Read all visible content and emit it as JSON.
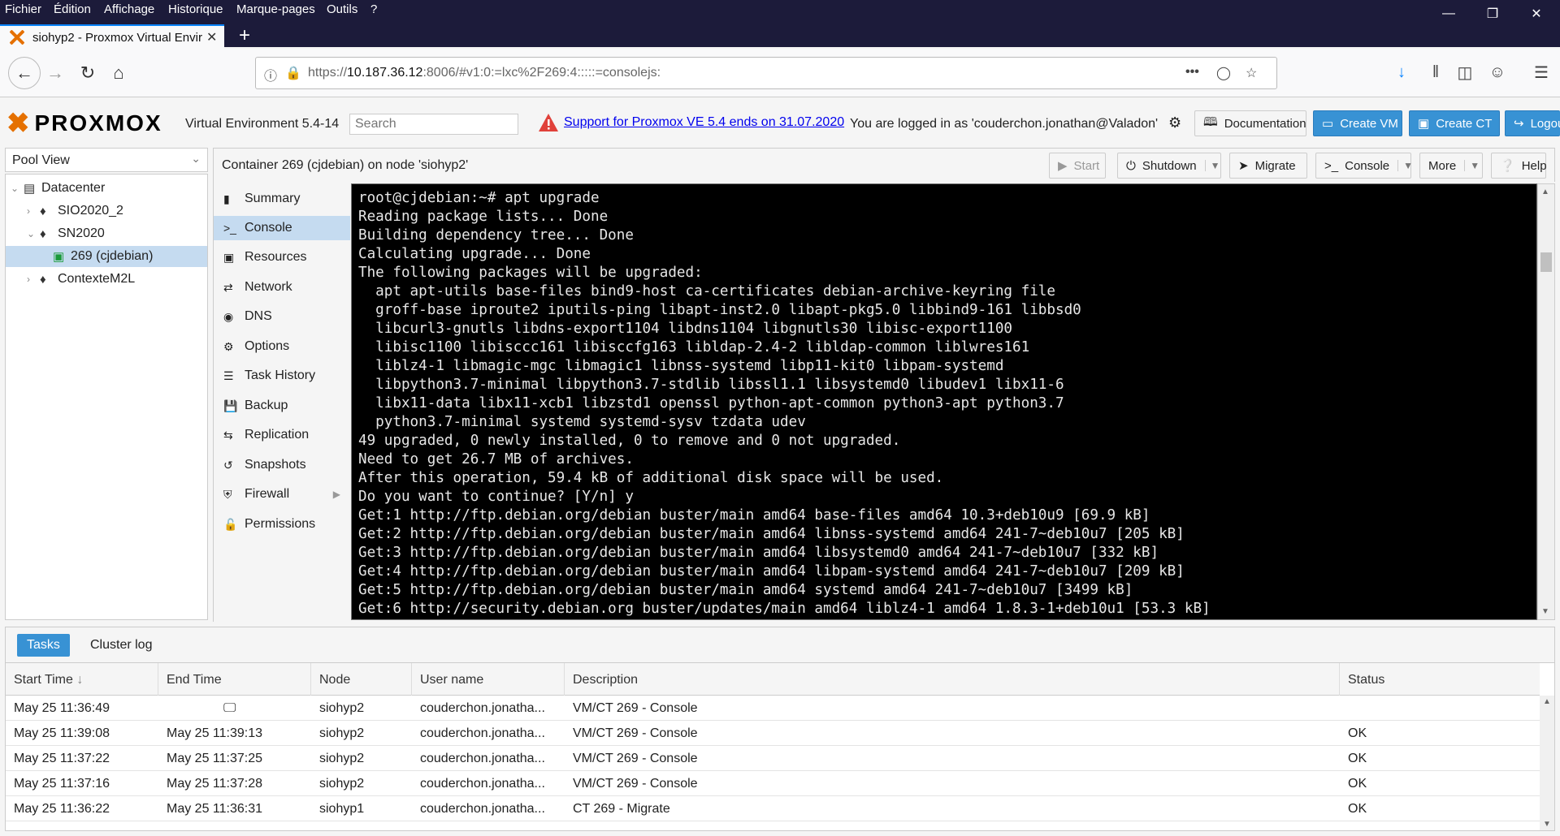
{
  "browser": {
    "menu": [
      "Fichier",
      "Édition",
      "Affichage",
      "Historique",
      "Marque-pages",
      "Outils",
      "?"
    ],
    "tab_title": "siohyp2 - Proxmox Virtual Envir",
    "url_prefix": "https://",
    "url_host": "10.187.36.12",
    "url_rest": ":8006/#v1:0:=lxc%2F269:4:::::=consolejs:"
  },
  "header": {
    "logo": "PROXMOX",
    "version": "Virtual Environment 5.4-14",
    "search_placeholder": "Search",
    "support_link": "Support for Proxmox VE 5.4 ends on 31.07.2020",
    "logged_in": "You are logged in as 'couderchon.jonathan@Valadon'",
    "documentation": "Documentation",
    "create_vm": "Create VM",
    "create_ct": "Create CT",
    "logout": "Logou"
  },
  "tree": {
    "view": "Pool View",
    "nodes": [
      "Datacenter",
      "SIO2020_2",
      "SN2020",
      "269 (cjdebian)",
      "ContexteM2L"
    ]
  },
  "content": {
    "title": "Container 269 (cjdebian) on node 'siohyp2'",
    "buttons": {
      "start": "Start",
      "shutdown": "Shutdown",
      "migrate": "Migrate",
      "console": "Console",
      "more": "More",
      "help": "Help"
    },
    "nav": [
      "Summary",
      "Console",
      "Resources",
      "Network",
      "DNS",
      "Options",
      "Task History",
      "Backup",
      "Replication",
      "Snapshots",
      "Firewall",
      "Permissions"
    ]
  },
  "terminal": {
    "lines": [
      "root@cjdebian:~# apt upgrade",
      "Reading package lists... Done",
      "Building dependency tree... Done",
      "Calculating upgrade... Done",
      "The following packages will be upgraded:",
      "  apt apt-utils base-files bind9-host ca-certificates debian-archive-keyring file",
      "  groff-base iproute2 iputils-ping libapt-inst2.0 libapt-pkg5.0 libbind9-161 libbsd0",
      "  libcurl3-gnutls libdns-export1104 libdns1104 libgnutls30 libisc-export1100",
      "  libisc1100 libisccc161 libisccfg163 libldap-2.4-2 libldap-common liblwres161",
      "  liblz4-1 libmagic-mgc libmagic1 libnss-systemd libp11-kit0 libpam-systemd",
      "  libpython3.7-minimal libpython3.7-stdlib libssl1.1 libsystemd0 libudev1 libx11-6",
      "  libx11-data libx11-xcb1 libzstd1 openssl python-apt-common python3-apt python3.7",
      "  python3.7-minimal systemd systemd-sysv tzdata udev",
      "49 upgraded, 0 newly installed, 0 to remove and 0 not upgraded.",
      "Need to get 26.7 MB of archives.",
      "After this operation, 59.4 kB of additional disk space will be used.",
      "Do you want to continue? [Y/n] y",
      "Get:1 http://ftp.debian.org/debian buster/main amd64 base-files amd64 10.3+deb10u9 [69.9 kB]",
      "Get:2 http://ftp.debian.org/debian buster/main amd64 libnss-systemd amd64 241-7~deb10u7 [205 kB]",
      "Get:3 http://ftp.debian.org/debian buster/main amd64 libsystemd0 amd64 241-7~deb10u7 [332 kB]",
      "Get:4 http://ftp.debian.org/debian buster/main amd64 libpam-systemd amd64 241-7~deb10u7 [209 kB]",
      "Get:5 http://ftp.debian.org/debian buster/main amd64 systemd amd64 241-7~deb10u7 [3499 kB]",
      "Get:6 http://security.debian.org buster/updates/main amd64 liblz4-1 amd64 1.8.3-1+deb10u1 [53.3 kB]"
    ]
  },
  "tasks": {
    "tabs": [
      "Tasks",
      "Cluster log"
    ],
    "columns": [
      "Start Time",
      "End Time",
      "Node",
      "User name",
      "Description",
      "Status"
    ],
    "rows": [
      [
        "May 25 11:36:49",
        "",
        "siohyp2",
        "couderchon.jonatha...",
        "VM/CT 269 - Console",
        ""
      ],
      [
        "May 25 11:39:08",
        "May 25 11:39:13",
        "siohyp2",
        "couderchon.jonatha...",
        "VM/CT 269 - Console",
        "OK"
      ],
      [
        "May 25 11:37:22",
        "May 25 11:37:25",
        "siohyp2",
        "couderchon.jonatha...",
        "VM/CT 269 - Console",
        "OK"
      ],
      [
        "May 25 11:37:16",
        "May 25 11:37:28",
        "siohyp2",
        "couderchon.jonatha...",
        "VM/CT 269 - Console",
        "OK"
      ],
      [
        "May 25 11:36:22",
        "May 25 11:36:31",
        "siohyp1",
        "couderchon.jonatha...",
        "CT 269 - Migrate",
        "OK"
      ]
    ]
  },
  "colors": {
    "accent": "#3892d4",
    "selected": "#c5dbf0",
    "logo_orange": "#e57000",
    "firefox_dark": "#1c1b3a"
  }
}
